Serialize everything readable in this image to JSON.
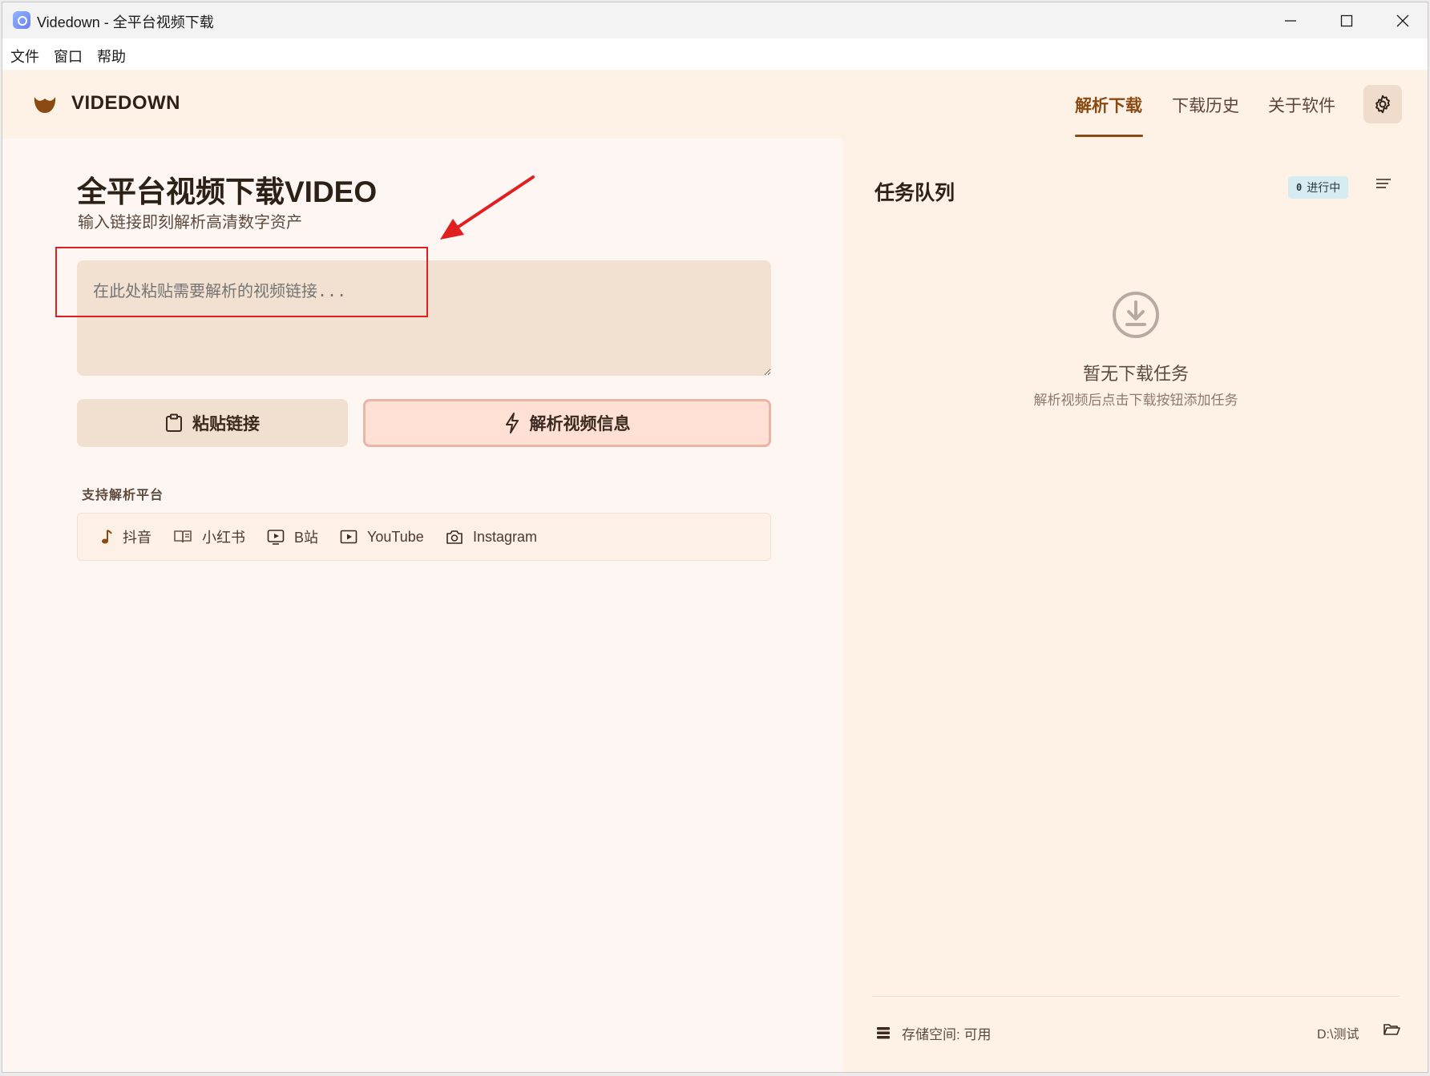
{
  "window": {
    "title": "Videdown - 全平台视频下载",
    "minimize_glyph": "–",
    "maximize_glyph": "□",
    "close_glyph": "×"
  },
  "menubar": {
    "items": [
      "文件",
      "窗口",
      "帮助"
    ]
  },
  "header": {
    "brand": "VIDEDOWN",
    "tabs": [
      {
        "label": "解析下载",
        "active": true
      },
      {
        "label": "下载历史",
        "active": false
      },
      {
        "label": "关于软件",
        "active": false
      }
    ],
    "settings_icon": "gear-icon",
    "accent_color": "#8b4a12"
  },
  "main": {
    "title": "全平台视频下载VIDEO",
    "subtitle": "输入链接即刻解析高清数字资产",
    "link_input": {
      "placeholder": "在此处粘贴需要解析的视频链接...",
      "value": ""
    },
    "paste_button": "粘贴链接",
    "parse_button": "解析视频信息",
    "platforms_label": "支持解析平台",
    "platforms": [
      {
        "label": "抖音",
        "icon": "music-note-icon"
      },
      {
        "label": "小红书",
        "icon": "book-icon"
      },
      {
        "label": "B站",
        "icon": "tv-play-icon"
      },
      {
        "label": "YouTube",
        "icon": "play-icon"
      },
      {
        "label": "Instagram",
        "icon": "camera-icon"
      }
    ]
  },
  "queue": {
    "title": "任务队列",
    "badge_count": "0",
    "badge_label": "进行中",
    "empty_title": "暂无下载任务",
    "empty_hint": "解析视频后点击下载按钮添加任务",
    "storage_label": "存储空间: 可用",
    "path": "D:\\测试"
  }
}
